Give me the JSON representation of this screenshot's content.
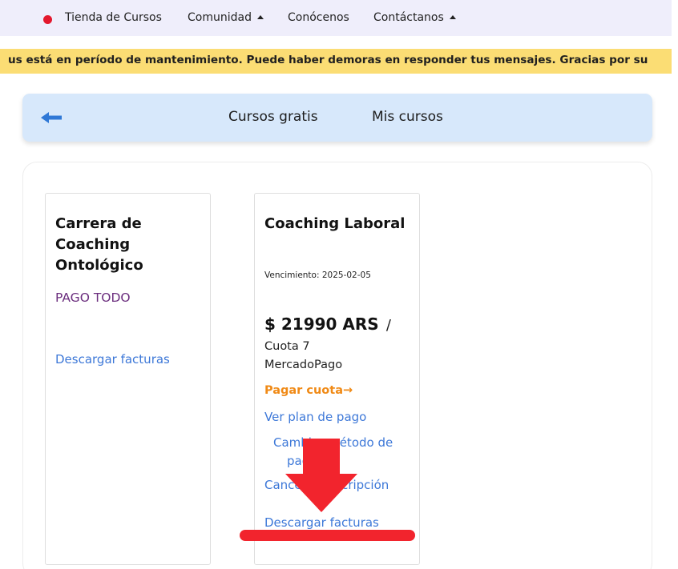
{
  "nav": {
    "store": "Tienda de Cursos",
    "community": "Comunidad",
    "about": "Conócenos",
    "contact": "Contáctanos"
  },
  "banner": {
    "text": "us está en período de mantenimiento. Puede haber demoras en responder tus mensajes. Gracias por su"
  },
  "tabs": {
    "free": "Cursos gratis",
    "mine": "Mis cursos"
  },
  "courses": [
    {
      "title": "Carrera de Coaching Ontológico",
      "status": "PAGO TODO",
      "invoices": "Descargar facturas"
    },
    {
      "title": "Coaching Laboral",
      "expiry": "Vencimiento: 2025-02-05",
      "price": "$ 21990 ARS",
      "price_sep": "/",
      "installment": "Cuota 7",
      "provider": "MercadoPago",
      "pay": "Pagar cuota→",
      "plan": "Ver plan de pago",
      "change_method_1": "Cambiar método de",
      "change_method_2": "pago",
      "cancel": "Cancelar suscripción",
      "invoices": "Descargar facturas"
    }
  ],
  "colors": {
    "nav_bg": "#efeefb",
    "banner_bg": "#fbdd74",
    "tabs_bg": "#d7e8fb",
    "link": "#3d78d8",
    "pay": "#f08a16",
    "status": "#6b2e7e",
    "annotation": "#f2242d"
  }
}
